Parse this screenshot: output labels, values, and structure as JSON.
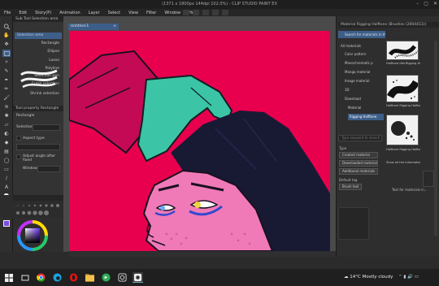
{
  "app": {
    "title": "(1371 x 1800px 144dpi 102.0%) - CLIP STUDIO PAINT EX"
  },
  "menu": [
    "File",
    "Edit",
    "Story(P)",
    "Animation",
    "Layer",
    "Select",
    "View",
    "Filter",
    "Window",
    "Help"
  ],
  "subtool": {
    "title": "Sub Tool Selection area",
    "items": [
      "Selection area",
      "Rectangle",
      "Ellipse",
      "Lasso",
      "Polyline",
      "Selection pen",
      "Erase selection",
      "Shrink selection"
    ]
  },
  "tool_property": {
    "title": "Tool property Rectangle",
    "tool_name": "Rectangle",
    "selection_label": "Selection",
    "aspect_type_label": "Aspect type",
    "adjust_after_fixed": "Adjust angle after fixed",
    "anti_alias_label": "Window"
  },
  "document": {
    "tab": "Untitled-1"
  },
  "material": {
    "header": "Material Rigging Halftone (Brushes (2004411))",
    "search_placeholder": "Search for materials in this",
    "tree": [
      {
        "label": "All materials",
        "selected": false
      },
      {
        "label": "Color pattern",
        "selected": false
      },
      {
        "label": "Monochromatic p",
        "selected": false
      },
      {
        "label": "Manga material",
        "selected": false
      },
      {
        "label": "Image material",
        "selected": false
      },
      {
        "label": "3D",
        "selected": false
      },
      {
        "label": "Download",
        "selected": false
      },
      {
        "label": "Material",
        "selected": false
      },
      {
        "label": "Rigging Halftone",
        "selected": true
      }
    ],
    "tag_search_placeholder": "Type keyword to search",
    "type_label": "Type",
    "buttons": [
      "Created material",
      "Downloaded material",
      "Additional materials"
    ],
    "default_tag_label": "Default tag",
    "default_tag": "Brush tool",
    "thumbs": [
      {
        "caption": "Halftone HairRigging Halftone"
      },
      {
        "caption": "Halftone Rigging Halftone 3"
      },
      {
        "caption": "Halftone Rigging Halftone 4"
      }
    ],
    "show_info": "Show all the information",
    "text_search": "Text for materials in..."
  },
  "colors": {
    "canvas_bg": "#e8004f",
    "hair": "#181a33",
    "glove": "#3cc4a6",
    "sleeve": "#c40a55",
    "skin": "#f07ab8",
    "accent": "#3d5e89"
  },
  "taskbar": {
    "weather_temp": "14°C",
    "weather_text": "Mostly cloudy"
  }
}
